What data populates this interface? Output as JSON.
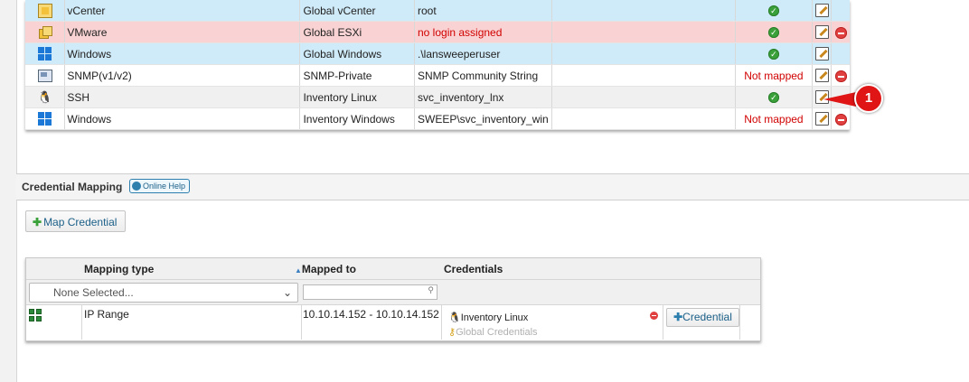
{
  "credentials": {
    "rows": [
      {
        "icon": "vcenter-icon",
        "name": "vCenter",
        "global": "Global vCenter",
        "user": "root",
        "status": "ok",
        "deletable": false,
        "style": "blue"
      },
      {
        "icon": "vmware-icon",
        "name": "VMware",
        "global": "Global ESXi",
        "user": "no login assigned",
        "status": "ok",
        "deletable": true,
        "style": "red"
      },
      {
        "icon": "windows-icon",
        "name": "Windows",
        "global": "Global Windows",
        "user": ".\\lansweeperuser",
        "status": "ok",
        "deletable": false,
        "style": "blue"
      },
      {
        "icon": "snmp-icon",
        "name": "SNMP(v1/v2)",
        "global": "SNMP-Private",
        "user": "SNMP Community String",
        "status": "Not mapped",
        "deletable": true,
        "style": "white"
      },
      {
        "icon": "linux-icon",
        "name": "SSH",
        "global": "Inventory Linux",
        "user": "svc_inventory_lnx",
        "status": "ok",
        "deletable": false,
        "style": "grey"
      },
      {
        "icon": "windows-icon",
        "name": "Windows",
        "global": "Inventory Windows",
        "user": "SWEEP\\svc_inventory_win",
        "status": "Not mapped",
        "deletable": true,
        "style": "white"
      }
    ]
  },
  "callout": {
    "number": "1"
  },
  "mapping_section": {
    "title": "Credential Mapping",
    "help_label": "Online Help",
    "map_button_label": "Map Credential",
    "headers": {
      "mapping_type": "Mapping type",
      "mapped_to": "Mapped to",
      "credentials": "Credentials"
    },
    "filter_select_value": "None Selected...",
    "row": {
      "mapping_type": "IP Range",
      "mapped_to": "10.10.14.152 - 10.10.14.152",
      "credential": "Inventory Linux",
      "credential_source": "Global Credentials",
      "add_label": "Credential"
    }
  }
}
